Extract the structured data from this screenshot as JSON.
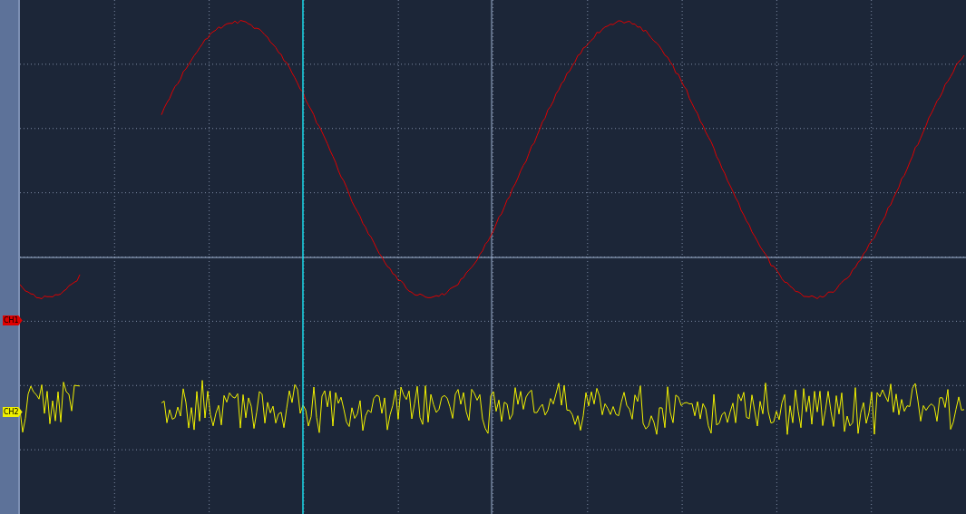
{
  "channels": [
    {
      "label": "CH1",
      "color": "#e00000"
    },
    {
      "label": "CH2",
      "color": "#f0f000"
    }
  ]
}
